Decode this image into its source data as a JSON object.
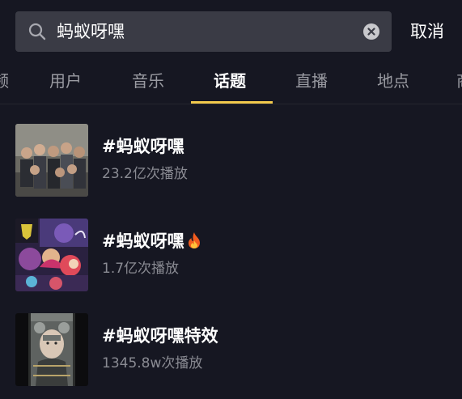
{
  "search": {
    "query": "蚂蚁呀嘿",
    "cancel_label": "取消"
  },
  "tabs": [
    {
      "label": "频",
      "active": false
    },
    {
      "label": "用户",
      "active": false
    },
    {
      "label": "音乐",
      "active": false
    },
    {
      "label": "话题",
      "active": true
    },
    {
      "label": "直播",
      "active": false
    },
    {
      "label": "地点",
      "active": false
    },
    {
      "label": "商",
      "active": false
    }
  ],
  "colors": {
    "background": "#161722",
    "search_box": "#3a3b45",
    "accent": "#f2c94c",
    "muted_text": "#8a8b93"
  },
  "results": [
    {
      "title": "#蚂蚁呀嘿",
      "views": "23.2亿次播放",
      "badge_icon": ""
    },
    {
      "title": "#蚂蚁呀嘿",
      "views": "1.7亿次播放",
      "badge_icon": "fire-icon"
    },
    {
      "title": "#蚂蚁呀嘿特效",
      "views": "1345.8w次播放",
      "badge_icon": ""
    }
  ]
}
